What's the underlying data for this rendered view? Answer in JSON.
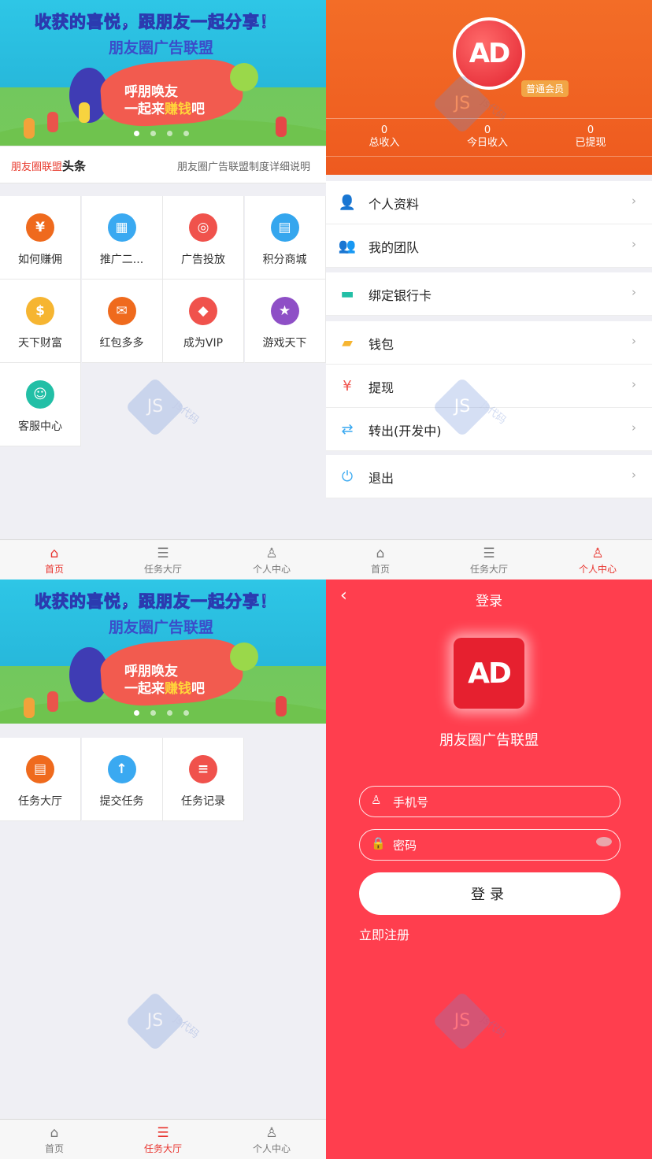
{
  "banner": {
    "line1": "收获的喜悦，跟朋友一起分享！",
    "line2": "朋友圈广告联盟",
    "slogan_a": "呼朋唤友",
    "slogan_b_prefix": "一起来",
    "slogan_b_highlight": "赚钱",
    "slogan_b_suffix": "吧"
  },
  "headline": {
    "brand": "朋友圈联盟",
    "brand_bold": "头条",
    "text": "朋友圈广告联盟制度详细说明"
  },
  "home_grid": [
    {
      "label": "如何赚佣",
      "icon": "yen-hand-icon",
      "color": "#ef6a1d",
      "glyph": "¥"
    },
    {
      "label": "推广二...",
      "icon": "qrcode-icon",
      "color": "#3aa9f1",
      "glyph": "▦"
    },
    {
      "label": "广告投放",
      "icon": "target-icon",
      "color": "#f0524c",
      "glyph": "◎"
    },
    {
      "label": "积分商城",
      "icon": "store-icon",
      "color": "#34a6ee",
      "glyph": "▤"
    },
    {
      "label": "天下财富",
      "icon": "coin-icon",
      "color": "#f6b531",
      "glyph": "$"
    },
    {
      "label": "红包多多",
      "icon": "red-packet-icon",
      "color": "#ef6a1d",
      "glyph": "✉"
    },
    {
      "label": "成为VIP",
      "icon": "diamond-icon",
      "color": "#f0524c",
      "glyph": "◆"
    },
    {
      "label": "游戏天下",
      "icon": "star-icon",
      "color": "#8e4fc6",
      "glyph": "★"
    },
    {
      "label": "客服中心",
      "icon": "headset-icon",
      "color": "#22bfa6",
      "glyph": "☺"
    }
  ],
  "task_grid": [
    {
      "label": "任务大厅",
      "icon": "task-hall-icon",
      "color": "#ef6a1d",
      "glyph": "▤"
    },
    {
      "label": "提交任务",
      "icon": "upload-icon",
      "color": "#3aa9f1",
      "glyph": "↑"
    },
    {
      "label": "任务记录",
      "icon": "record-icon",
      "color": "#f0524c",
      "glyph": "≡"
    }
  ],
  "tabs": [
    {
      "label": "首页",
      "icon": "home-icon",
      "glyph": "⌂"
    },
    {
      "label": "任务大厅",
      "icon": "list-icon",
      "glyph": "☰"
    },
    {
      "label": "个人中心",
      "icon": "user-icon",
      "glyph": "♙"
    }
  ],
  "profile": {
    "logo": "AD",
    "member_badge": "普通会员",
    "stats": [
      {
        "value": "0",
        "label": "总收入"
      },
      {
        "value": "0",
        "label": "今日收入"
      },
      {
        "value": "0",
        "label": "已提现"
      }
    ],
    "menu1": [
      {
        "label": "个人资料",
        "icon": "profile-icon",
        "glyph": "👤",
        "color": "#ef6a1d"
      },
      {
        "label": "我的团队",
        "icon": "team-icon",
        "glyph": "👥",
        "color": "#f0524c"
      }
    ],
    "menu2": [
      {
        "label": "绑定银行卡",
        "icon": "bank-card-icon",
        "glyph": "▬",
        "color": "#22bfa6"
      }
    ],
    "menu3": [
      {
        "label": "钱包",
        "icon": "wallet-icon",
        "glyph": "▰",
        "color": "#f6b531"
      },
      {
        "label": "提现",
        "icon": "withdraw-icon",
        "glyph": "¥",
        "color": "#f0524c"
      },
      {
        "label": "转出(开发中)",
        "icon": "transfer-icon",
        "glyph": "⇄",
        "color": "#3aa9f1"
      }
    ],
    "menu4": [
      {
        "label": "退出",
        "icon": "power-icon",
        "glyph": "⏻",
        "color": "#3aa9f1"
      }
    ],
    "arrow": "›"
  },
  "login": {
    "title": "登录",
    "back": "‹",
    "logo": "AD",
    "app_name": "朋友圈广告联盟",
    "phone_placeholder": "手机号",
    "password_placeholder": "密码",
    "button": "登录",
    "register": "立即注册"
  },
  "watermark": {
    "badge": "JS",
    "text": "js代码"
  }
}
